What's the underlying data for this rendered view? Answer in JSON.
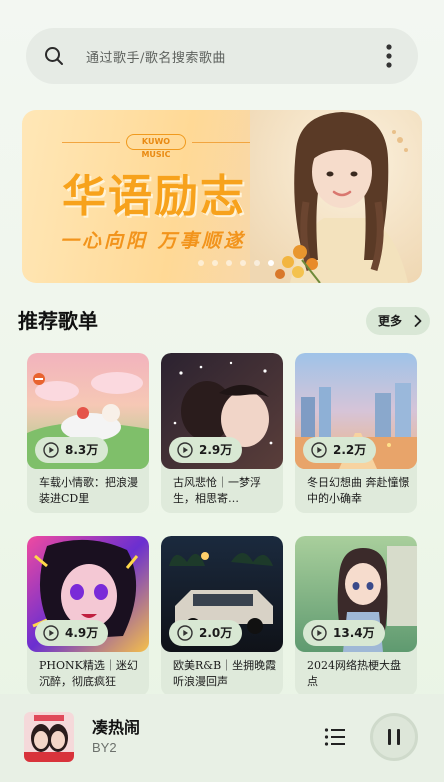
{
  "search": {
    "placeholder": "通过歌手/歌名搜索歌曲"
  },
  "banner": {
    "brand": "KUWO MUSIC",
    "headline": "华语励志",
    "tagline": "一心向阳 万事顺遂",
    "active_slide": 6,
    "slide_count": 6
  },
  "section": {
    "title": "推荐歌单",
    "more_label": "更多"
  },
  "playlists": [
    {
      "count": "8.3万",
      "title": "车载小情歌：把浪漫装进CD里"
    },
    {
      "count": "2.9万",
      "title": "古风悲怆｜一梦浮生，相思寄…"
    },
    {
      "count": "2.2万",
      "title": "冬日幻想曲 奔赴憧憬中的小确幸"
    },
    {
      "count": "4.9万",
      "title": "PHONK精选｜迷幻沉醉，彻底疯狂"
    },
    {
      "count": "2.0万",
      "title": "欧美R&B｜坐拥晚霞听浪漫回声"
    },
    {
      "count": "13.4万",
      "title": "2024网络热梗大盘点"
    }
  ],
  "player": {
    "song": "凑热闹",
    "artist": "BY2"
  },
  "colors": {
    "accent": "#f7a21c",
    "chip_bg": "#d8e8d3",
    "player_bg": "#e8f0e5"
  },
  "icons": [
    "search-icon",
    "more-vertical-icon",
    "chevron-right-icon",
    "play-circle-icon",
    "playlist-icon",
    "pause-icon"
  ]
}
